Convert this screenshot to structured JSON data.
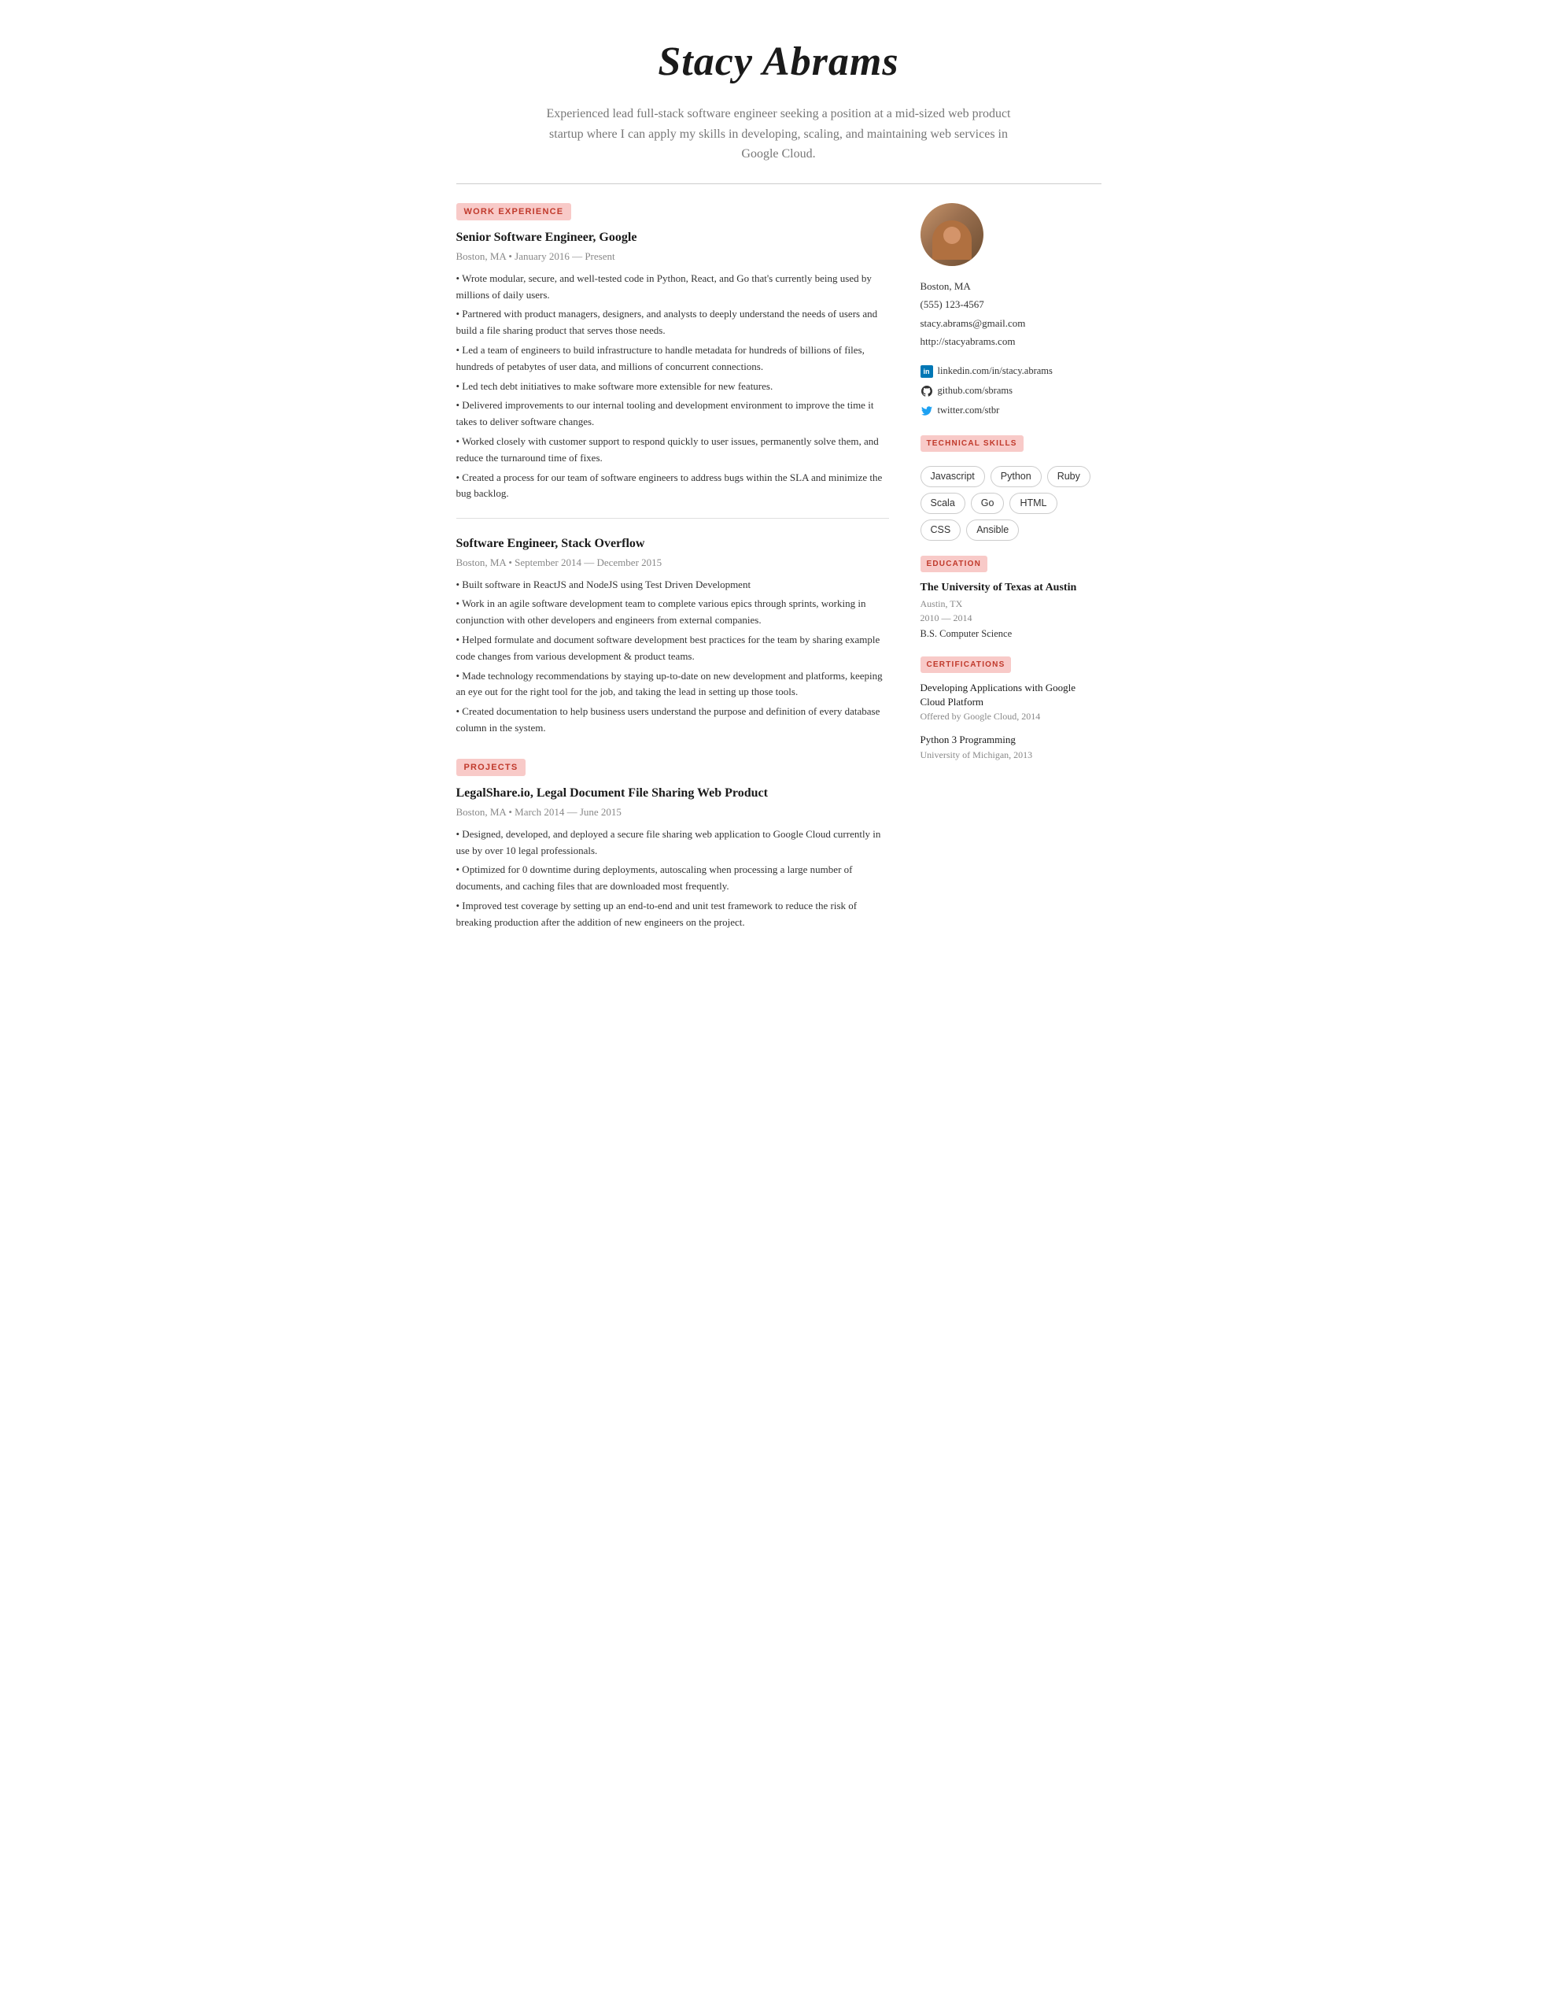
{
  "header": {
    "name": "Stacy Abrams",
    "summary": "Experienced lead full-stack software engineer seeking a position at a mid-sized web product startup where I can apply my skills in developing, scaling, and maintaining web services in Google Cloud."
  },
  "sections": {
    "work_experience_label": "WORK EXPERIENCE",
    "projects_label": "PROJECTS"
  },
  "jobs": [
    {
      "title": "Senior Software Engineer, Google",
      "location": "Boston, MA",
      "dates": "January 2016 — Present",
      "bullets": [
        "• Wrote modular, secure, and well-tested code in Python, React, and Go that's currently being used by millions of daily users.",
        "• Partnered with product managers, designers, and analysts to deeply understand the needs of users and build a file sharing product that serves those needs.",
        "• Led a team of engineers to build infrastructure to handle metadata for hundreds of billions of files, hundreds of petabytes of user data, and millions of concurrent connections.",
        "• Led tech debt initiatives to make software more extensible for new features.",
        "• Delivered improvements to our internal tooling and development environment to improve the time it takes to deliver software changes.",
        "• Worked closely with customer support to respond quickly to user issues, permanently solve them, and reduce the turnaround time of fixes.",
        "• Created a process for our team of software engineers to address bugs within the SLA and minimize the bug backlog."
      ]
    },
    {
      "title": "Software Engineer, Stack Overflow",
      "location": "Boston, MA",
      "dates": "September 2014 — December 2015",
      "bullets": [
        "• Built software in ReactJS and NodeJS using Test Driven Development",
        "• Work in an agile software development team to complete various epics through sprints, working in conjunction with other developers and engineers from external companies.",
        "• Helped formulate and document software development best practices for the team by sharing example code changes from various development & product teams.",
        "• Made technology recommendations by staying up-to-date on new development and platforms, keeping an eye out for the right tool for the job, and taking the lead in setting up those tools.",
        "• Created documentation to help business users understand the purpose and definition of every database column in the system."
      ]
    }
  ],
  "projects": [
    {
      "title": "LegalShare.io, Legal Document File Sharing Web Product",
      "location": "Boston, MA",
      "dates": "March 2014 — June 2015",
      "bullets": [
        "• Designed, developed, and deployed a secure file sharing web application to Google Cloud currently in use by over 10 legal professionals.",
        "• Optimized for 0 downtime during deployments, autoscaling when processing a large number of documents, and caching files that are downloaded most frequently.",
        "• Improved test coverage by setting up an end-to-end and unit test framework to reduce the risk of breaking production after the addition of new engineers on the project."
      ]
    }
  ],
  "sidebar": {
    "contact": {
      "city": "Boston, MA",
      "phone": "(555) 123-4567",
      "email": "stacy.abrams@gmail.com",
      "website": "http://stacyabrams.com"
    },
    "social": [
      {
        "platform": "linkedin",
        "handle": "linkedin.com/in/stacy.abrams",
        "icon": "in"
      },
      {
        "platform": "github",
        "handle": "github.com/sbrams",
        "icon": "◎"
      },
      {
        "platform": "twitter",
        "handle": "twitter.com/stbr",
        "icon": "🐦"
      }
    ],
    "technical_skills_label": "TECHNICAL SKILLS",
    "skills": [
      "Javascript",
      "Python",
      "Ruby",
      "Scala",
      "Go",
      "HTML",
      "CSS",
      "Ansible"
    ],
    "education_label": "EDUCATION",
    "education": {
      "school": "The University of Texas at Austin",
      "location": "Austin, TX",
      "dates": "2010 — 2014",
      "degree": "B.S. Computer Science"
    },
    "certifications_label": "CERTIFICATIONS",
    "certifications": [
      {
        "name": "Developing Applications with Google Cloud Platform",
        "issuer": "Offered by Google Cloud, 2014"
      },
      {
        "name": "Python 3 Programming",
        "issuer": "University of Michigan, 2013"
      }
    ]
  }
}
